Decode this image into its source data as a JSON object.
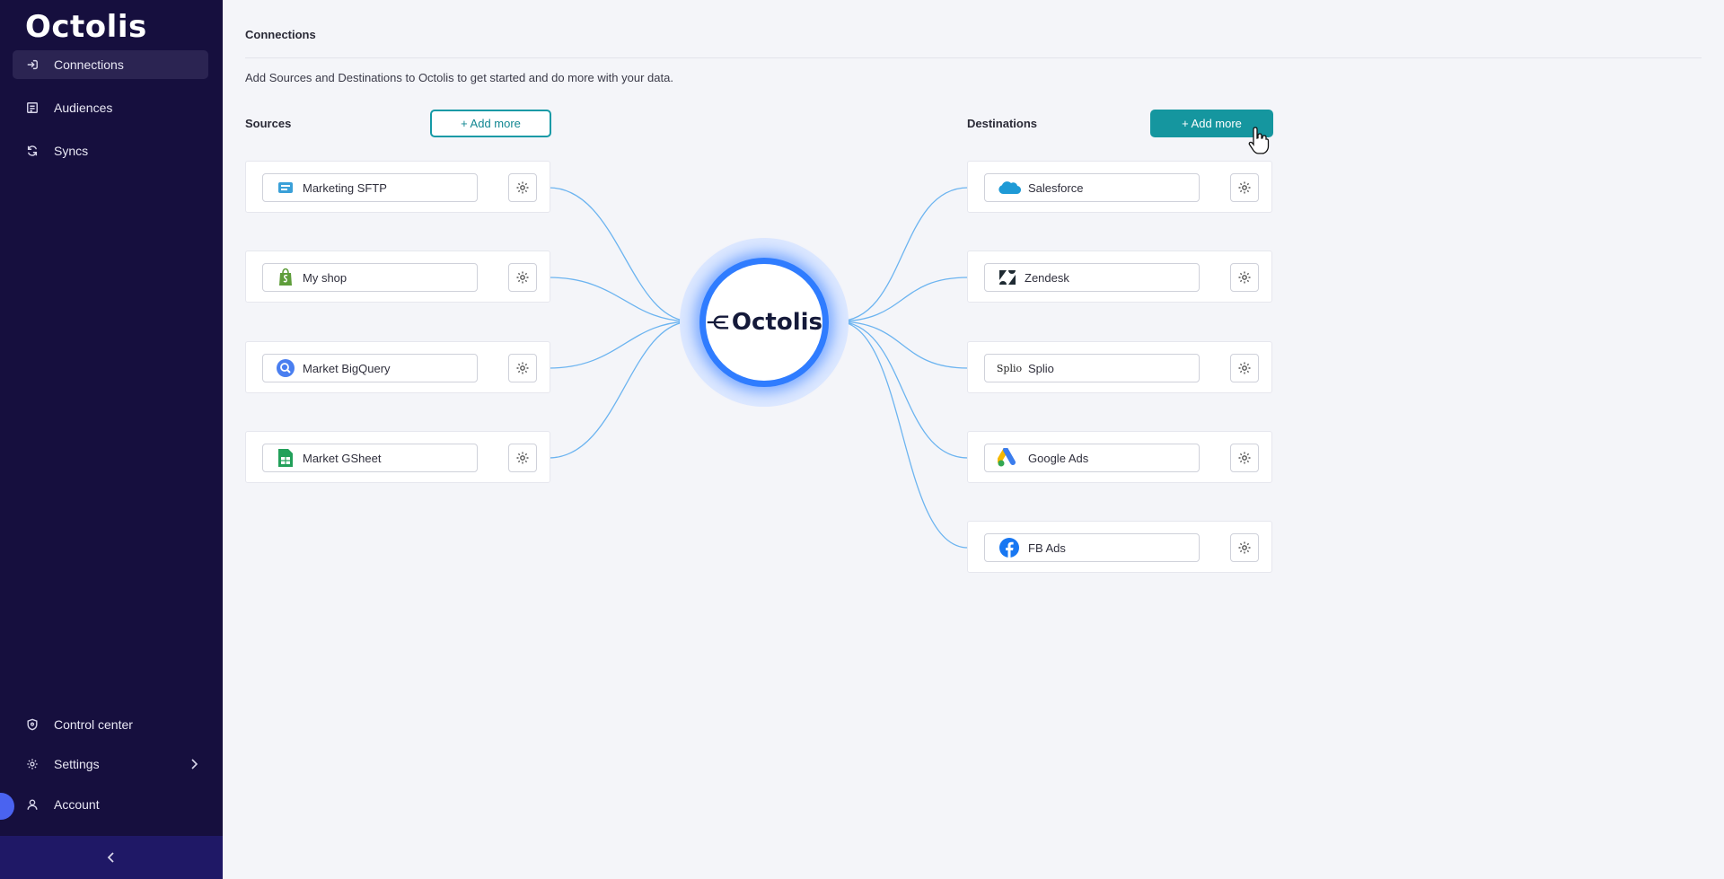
{
  "app": {
    "logo_text": "Octolis"
  },
  "sidebar": {
    "items": [
      {
        "label": "Connections",
        "icon": "connections-icon",
        "active": true
      },
      {
        "label": "Audiences",
        "icon": "audiences-icon",
        "active": false
      },
      {
        "label": "Syncs",
        "icon": "syncs-icon",
        "active": false
      }
    ],
    "bottom_items": [
      {
        "label": "Control center",
        "icon": "shield-icon"
      },
      {
        "label": "Settings",
        "icon": "gear-icon"
      },
      {
        "label": "Account",
        "icon": "user-icon"
      }
    ],
    "collapse_icon": "chevron-left-icon"
  },
  "main": {
    "title": "Connections",
    "subtitle": "Add Sources and Destinations to Octolis to get started and do more with your data.",
    "sources_label": "Sources",
    "destinations_label": "Destinations",
    "add_more_label": "+ Add more",
    "hub_text": "Octolis",
    "sources": [
      {
        "name": "Marketing SFTP",
        "icon": "sftp-icon"
      },
      {
        "name": "My shop",
        "icon": "shopify-icon"
      },
      {
        "name": "Market BigQuery",
        "icon": "bigquery-icon"
      },
      {
        "name": "Market GSheet",
        "icon": "gsheet-icon"
      }
    ],
    "destinations": [
      {
        "name": "Salesforce",
        "icon": "salesforce-icon"
      },
      {
        "name": "Zendesk",
        "icon": "zendesk-icon"
      },
      {
        "name": "Splio",
        "icon": "splio-icon",
        "logo_text": "Splio"
      },
      {
        "name": "Google Ads",
        "icon": "google-ads-icon"
      },
      {
        "name": "FB Ads",
        "icon": "facebook-icon"
      }
    ]
  },
  "colors": {
    "sidebar_bg": "#160f3e",
    "accent_teal": "#15969f",
    "link_blue": "#6cb4f0",
    "hub_blue": "#2f7cff"
  }
}
